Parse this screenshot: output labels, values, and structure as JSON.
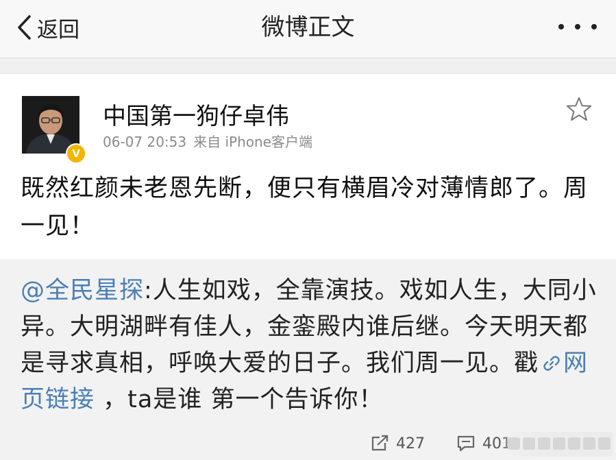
{
  "nav": {
    "back_label": "返回",
    "title": "微博正文"
  },
  "post": {
    "author": "中国第一狗仔卓伟",
    "time": "06-07 20:53",
    "source": "来自 iPhone客户端",
    "badge": "V",
    "text": "既然红颜未老恩先断，便只有横眉冷对薄情郎了。周一见！"
  },
  "retweet": {
    "mention": "@全民星探",
    "text_before_link": ":人生如戏，全靠演技。戏如人生，大同小异。大明湖畔有佳人，金銮殿内谁后继。今天明天都是寻求真相，呼唤大爱的日子。我们周一见。戳",
    "link_label": "网页链接",
    "text_after_link": " ，ta是谁 第一个告诉你！"
  },
  "actions": {
    "repost_count": "427",
    "comment_count": "401"
  },
  "colors": {
    "link": "#4a7fb5",
    "verified_badge": "#f4b400",
    "retweet_bg": "#f2f2f2"
  }
}
